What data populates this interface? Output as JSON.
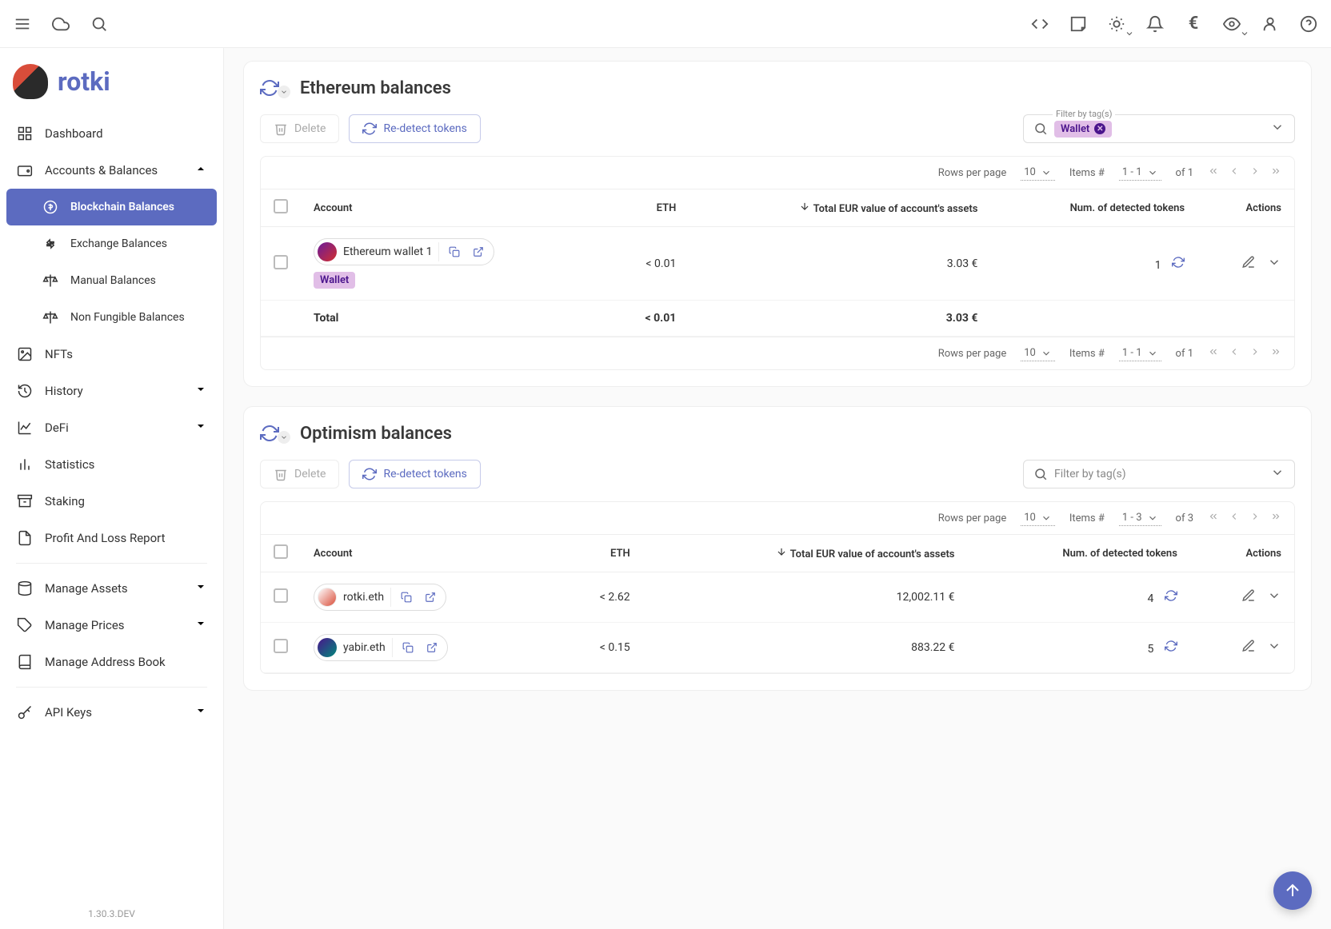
{
  "brand": {
    "name": "rotki"
  },
  "version": "1.30.3.DEV",
  "sidebar": {
    "dashboard": "Dashboard",
    "accounts_balances": "Accounts & Balances",
    "blockchain": "Blockchain Balances",
    "exchange": "Exchange Balances",
    "manual": "Manual Balances",
    "nft_balances": "Non Fungible Balances",
    "nfts": "NFTs",
    "history": "History",
    "defi": "DeFi",
    "statistics": "Statistics",
    "staking": "Staking",
    "pnl": "Profit And Loss Report",
    "manage_assets": "Manage Assets",
    "manage_prices": "Manage Prices",
    "address_book": "Manage Address Book",
    "api_keys": "API Keys"
  },
  "sections": [
    {
      "title": "Ethereum balances",
      "delete_label": "Delete",
      "redetect_label": "Re-detect tokens",
      "filter_label": "Filter by tag(s)",
      "filter_tag": "Wallet",
      "columns": {
        "account": "Account",
        "eth": "ETH",
        "total_eur": "Total EUR value of account's assets",
        "tokens": "Num. of detected tokens",
        "actions": "Actions"
      },
      "pagination": {
        "rows_label": "Rows per page",
        "rows": "10",
        "items_label": "Items #",
        "range": "1 - 1",
        "of": "of 1"
      },
      "rows": [
        {
          "name": "Ethereum wallet 1",
          "tags": [
            "Wallet"
          ],
          "eth": "< 0.01",
          "total": "3.03 €",
          "tokens": "1"
        }
      ],
      "total_row": {
        "label": "Total",
        "eth": "< 0.01",
        "total": "3.03 €"
      }
    },
    {
      "title": "Optimism balances",
      "delete_label": "Delete",
      "redetect_label": "Re-detect tokens",
      "filter_label": "",
      "filter_placeholder": "Filter by tag(s)",
      "columns": {
        "account": "Account",
        "eth": "ETH",
        "total_eur": "Total EUR value of account's assets",
        "tokens": "Num. of detected tokens",
        "actions": "Actions"
      },
      "pagination": {
        "rows_label": "Rows per page",
        "rows": "10",
        "items_label": "Items #",
        "range": "1 - 3",
        "of": "of 3"
      },
      "rows": [
        {
          "name": "rotki.eth",
          "tags": [],
          "eth": "< 2.62",
          "total": "12,002.11 €",
          "tokens": "4",
          "avatar": "a2"
        },
        {
          "name": "yabir.eth",
          "tags": [],
          "eth": "< 0.15",
          "total": "883.22 €",
          "tokens": "5",
          "avatar": "a3"
        }
      ]
    }
  ]
}
